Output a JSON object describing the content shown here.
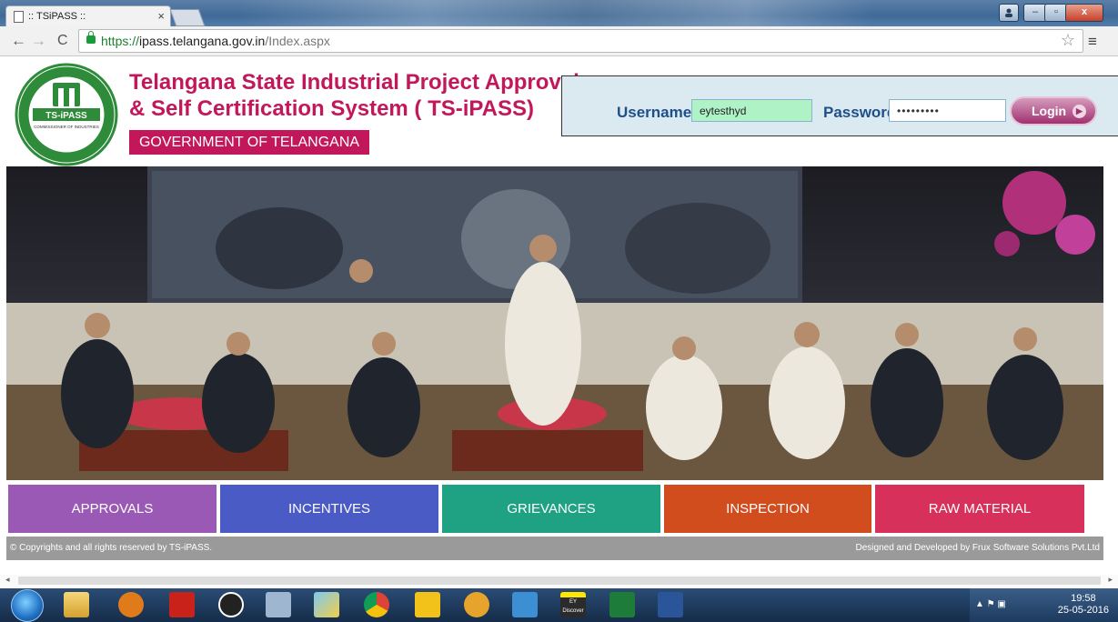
{
  "browser": {
    "tab_title": ":: TSiPASS ::",
    "tab_close": "×",
    "url_scheme": "https://",
    "url_host": "ipass.telangana.gov.in",
    "url_path": "/Index.aspx",
    "nav_back": "←",
    "nav_forward": "→",
    "nav_reload": "C",
    "star": "☆",
    "menu": "≡",
    "window_controls": {
      "minimize": "–",
      "maximize": "▫",
      "close": "x"
    }
  },
  "header": {
    "title_line1": "Telangana State Industrial Project Approval",
    "title_line2": "& Self Certification System ( TS-iPASS)",
    "government": "GOVERNMENT OF TELANGANA",
    "logo": {
      "ring_top": "GOVERNMENT OF TELANGANA",
      "ring_bottom": "INDUSTRIES & COMMERCE DEPARTMENT",
      "band": "TS-iPASS",
      "sub": "COMMISSIONER OF INDUSTRIES"
    }
  },
  "login": {
    "username_label": "Username",
    "username_value": "eytesthyd",
    "password_label": "Password",
    "password_value": "•••••••••",
    "login_button": "Login",
    "login_arrow": "▶"
  },
  "nav_tiles": [
    {
      "label": "APPROVALS",
      "color": "#9b59b6"
    },
    {
      "label": "INCENTIVES",
      "color": "#4b5bc5"
    },
    {
      "label": "GRIEVANCES",
      "color": "#1fa184"
    },
    {
      "label": "INSPECTION",
      "color": "#d24d1e"
    },
    {
      "label": "RAW MATERIAL",
      "color": "#d7305a"
    }
  ],
  "footer": {
    "copyright": "© Copyrights and all rights reserved by TS-iPASS.",
    "credit": "Designed and Developed by Frux Software Solutions Pvt.Ltd"
  },
  "scrollbar": {
    "left_arrow": "◂",
    "right_arrow": "▸"
  },
  "taskbar": {
    "apps": [
      "file-explorer-icon",
      "outlook-icon",
      "acrobat-icon",
      "p-app-icon",
      "calculator-icon",
      "folder-icon",
      "chrome-icon",
      "help-icon",
      "app-icon",
      "lync-icon",
      "ey-discover-icon",
      "excel-icon",
      "word-icon"
    ],
    "ey_label": "EY Discover",
    "tray_icons": "▲  ⚑  ▣",
    "time": "19:58",
    "date": "25-05-2016"
  }
}
